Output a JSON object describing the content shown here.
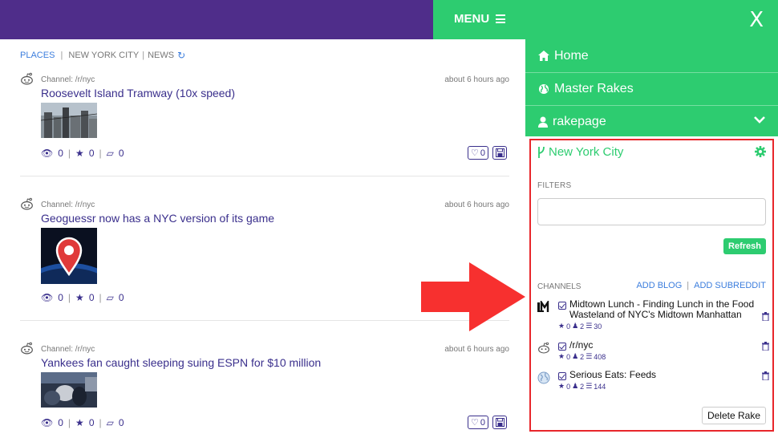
{
  "header": {
    "menu_label": "MENU",
    "close_label": "X",
    "bg_color": "#4f2d8a",
    "accent_color": "#2dcc70"
  },
  "breadcrumb": {
    "places": "PLACES",
    "city": "NEW YORK CITY",
    "news": "NEWS"
  },
  "posts": [
    {
      "channel": "Channel: /r/nyc",
      "time": "about 6 hours ago",
      "title": "Roosevelt Island Tramway (10x speed)",
      "views": "0",
      "stars": "0",
      "shares": "0",
      "likes": "0"
    },
    {
      "channel": "Channel: /r/nyc",
      "time": "about 6 hours ago",
      "title": "Geoguessr now has a NYC version of its game",
      "views": "0",
      "stars": "0",
      "shares": "0"
    },
    {
      "channel": "Channel: /r/nyc",
      "time": "about 6 hours ago",
      "title": "Yankees fan caught sleeping suing ESPN for $10 million",
      "views": "0",
      "stars": "0",
      "shares": "0",
      "likes": "0"
    }
  ],
  "nav": {
    "home": "Home",
    "master_rakes": "Master Rakes",
    "rakepage": "rakepage"
  },
  "rake": {
    "title": "New York City",
    "filters_label": "FILTERS",
    "filter_value": "",
    "refresh_label": "Refresh",
    "channels_label": "CHANNELS",
    "add_blog": "ADD BLOG",
    "add_subreddit": "ADD SUBREDDIT",
    "delete_label": "Delete Rake",
    "channels": [
      {
        "name": "Midtown Lunch - Finding Lunch in the Food Wasteland of NYC's Midtown Manhattan",
        "stars": "0",
        "users": "2",
        "items": "30",
        "icon": "midtown-lunch-logo-icon"
      },
      {
        "name": "/r/nyc",
        "stars": "0",
        "users": "2",
        "items": "408",
        "icon": "reddit-icon"
      },
      {
        "name": "Serious Eats: Feeds",
        "stars": "0",
        "users": "2",
        "items": "144",
        "icon": "globe-icon"
      }
    ]
  }
}
